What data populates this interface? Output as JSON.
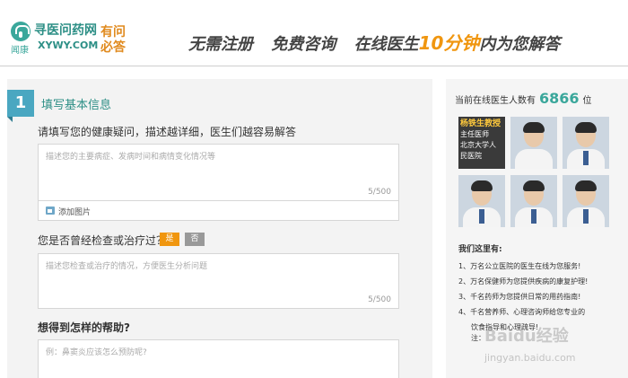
{
  "header": {
    "logo_name": "寻医问药网",
    "logo_domain": "XYWY.COM",
    "logo_sub": "闻康",
    "slogan_line1": "有问",
    "slogan_line2": "必答",
    "tagline_part1": "无需注册",
    "tagline_part2": "免费咨询",
    "tagline_part3_prefix": "在线医生",
    "tagline_highlight": "10分钟",
    "tagline_part3_suffix": "内为您解答"
  },
  "form": {
    "step_number": "1",
    "step_title": "填写基本信息",
    "question1": "请填写您的健康疑问，描述越详细，医生们越容易解答",
    "q1_placeholder": "描述您的主要病症、发病时间和病情变化情况等",
    "q1_count": "5/500",
    "attach_label": "添加图片",
    "question2": "您是否曾经检查或治疗过？",
    "yes_label": "是",
    "no_label": "否",
    "q2_placeholder": "描述您检查或治疗的情况，方便医生分析问题",
    "q2_count": "5/500",
    "question3": "想得到怎样的帮助?",
    "q3_placeholder": "例：鼻窦炎应该怎么预防呢?"
  },
  "sidebar": {
    "online_prefix": "当前在线医生人数有",
    "online_count": "6866",
    "online_suffix": "位",
    "featured_doctor": {
      "name": "杨铁生教授",
      "title": "主任医师",
      "hospital_line1": "北京大学人",
      "hospital_line2": "民医院"
    },
    "offer_title": "我们这里有:",
    "offers": [
      "1、万名公立医院的医生在线为您服务!",
      "2、万名保健师为您提供疾病的康复护理!",
      "3、千名药师为您提供日常的用药指南!",
      "4、千名营养师、心理咨询师给您专业的"
    ],
    "offer_continuation": "饮食指导和心理疏导!",
    "offer_note": "注："
  },
  "watermark": {
    "text": "Baidu经验",
    "url": "jingyan.baidu.com"
  },
  "colors": {
    "brand_teal": "#3aa79b",
    "accent_orange": "#f0960f",
    "step_blue": "#4aa7c1"
  }
}
